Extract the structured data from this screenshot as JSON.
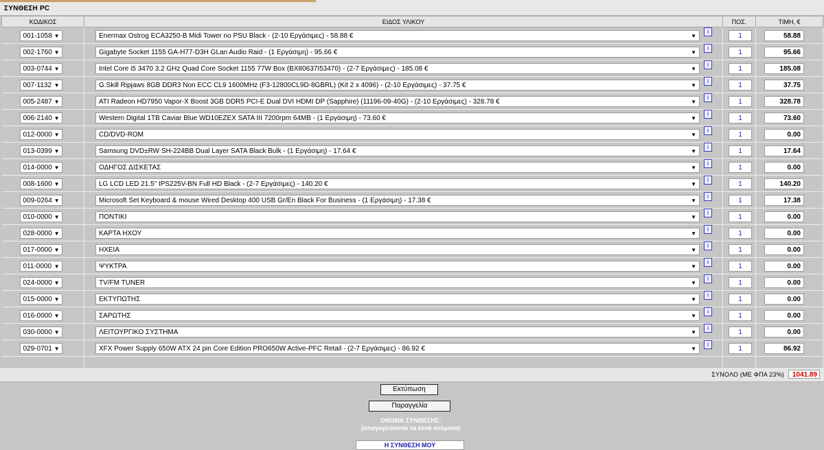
{
  "title": "ΣΥΝΘΕΣΗ PC",
  "headers": {
    "code": "ΚΩΔΙΚΟΣ",
    "item": "ΕΙΔΟΣ ΥΛΙΚΟΥ",
    "qty": "ΠΟΣ.",
    "price": "ΤΙΜΗ, €"
  },
  "rows": [
    {
      "code": "001-1058",
      "desc": "Enermax Ostrog ECA3250-B Midi Tower no PSU Black - (2-10 Εργάσιμες) - 58.88 €",
      "qty": "1",
      "price": "58.88"
    },
    {
      "code": "002-1760",
      "desc": "Gigabyte Socket 1155 GA-H77-D3H GLan Audio Raid - (1 Εργάσιμη) - 95.66 €",
      "qty": "1",
      "price": "95.66"
    },
    {
      "code": "003-0744",
      "desc": "Intel Core i5 3470 3.2 GHz Quad Core Socket 1155 77W Box (BX80637I53470) - (2-7 Εργάσιμες) - 185.08 €",
      "qty": "1",
      "price": "185.08"
    },
    {
      "code": "007-1132",
      "desc": "G.Skill Ripjaws 8GB DDR3 Non ECC CL9 1600MHz (F3-12800CL9D-8GBRL) (Kit 2 x 4096) - (2-10 Εργάσιμες) - 37.75 €",
      "qty": "1",
      "price": "37.75"
    },
    {
      "code": "005-2487",
      "desc": "ATI Radeon HD7950 Vapor-X Boost 3GB DDR5 PCI-E Dual DVI HDMI DP (Sapphire) (11196-09-40G) - (2-10 Εργάσιμες) - 328.78 €",
      "qty": "1",
      "price": "328.78"
    },
    {
      "code": "006-2140",
      "desc": "Western Digital 1TB Caviar Blue WD10EZEX SATA III 7200rpm 64MB - (1 Εργάσιμη) - 73.60 €",
      "qty": "1",
      "price": "73.60"
    },
    {
      "code": "012-0000",
      "desc": "CD/DVD-ROM",
      "qty": "1",
      "price": "0.00"
    },
    {
      "code": "013-0399",
      "desc": "Samsung DVD±RW SH-224BB Dual Layer SATA Black Bulk - (1 Εργάσιμη) - 17.64 €",
      "qty": "1",
      "price": "17.64"
    },
    {
      "code": "014-0000",
      "desc": "ΟΔΗΓΟΣ ΔΙΣΚΕΤΑΣ",
      "qty": "1",
      "price": "0.00"
    },
    {
      "code": "008-1600",
      "desc": "LG LCD LED 21.5\" IPS225V-BN Full HD Black - (2-7 Εργάσιμες) - 140.20 €",
      "qty": "1",
      "price": "140.20"
    },
    {
      "code": "009-0264",
      "desc": "Microsoft Set Keyboard & mouse Wired Desktop 400 USB Gr/En Black For Business - (1 Εργάσιμη) - 17.38 €",
      "qty": "1",
      "price": "17.38"
    },
    {
      "code": "010-0000",
      "desc": "ΠΟΝΤΙΚΙ",
      "qty": "1",
      "price": "0.00"
    },
    {
      "code": "028-0000",
      "desc": "ΚΑΡΤΑ ΗΧΟΥ",
      "qty": "1",
      "price": "0.00"
    },
    {
      "code": "017-0000",
      "desc": "ΗΧΕΙΑ",
      "qty": "1",
      "price": "0.00"
    },
    {
      "code": "011-0000",
      "desc": "ΨΥΚΤΡΑ",
      "qty": "1",
      "price": "0.00"
    },
    {
      "code": "024-0000",
      "desc": "TV/FM TUNER",
      "qty": "1",
      "price": "0.00"
    },
    {
      "code": "015-0000",
      "desc": "ΕΚΤΥΠΩΤΗΣ",
      "qty": "1",
      "price": "0.00"
    },
    {
      "code": "016-0000",
      "desc": "ΣΑΡΩΤΗΣ",
      "qty": "1",
      "price": "0.00"
    },
    {
      "code": "030-0000",
      "desc": "ΛΕΙΤΟΥΡΓΙΚΟ ΣΥΣΤΗΜΑ",
      "qty": "1",
      "price": "0.00"
    },
    {
      "code": "029-0701",
      "desc": "XFX Power Supply 650W ATX 24 pin Core Edition PRO650W Active-PFC Retail - (2-7 Εργάσιμες) - 86.92 €",
      "qty": "1",
      "price": "86.92"
    }
  ],
  "info_label": "i",
  "total": {
    "label": "ΣΥΝΟΛΟ (ΜΕ ΦΠΑ 23%)",
    "value": "1041.89"
  },
  "buttons": {
    "print": "Εκτύπωση",
    "order": "Παραγγελία"
  },
  "name_section": {
    "caption_line1": "ΟΝΟΜΑ ΣΥΝΘΕΣΗΣ:",
    "caption_line2": "(απαγορεύονται τα κενά ονόματα)",
    "value": "Η ΣΥΝΘΕΣΗ ΜΟΥ"
  },
  "icons": {
    "dropdown": "chevron-down-icon",
    "info": "info-icon"
  },
  "colors": {
    "total_value": "#c00000",
    "qty_text": "#1d22a8",
    "background": "#c6c6c6"
  }
}
